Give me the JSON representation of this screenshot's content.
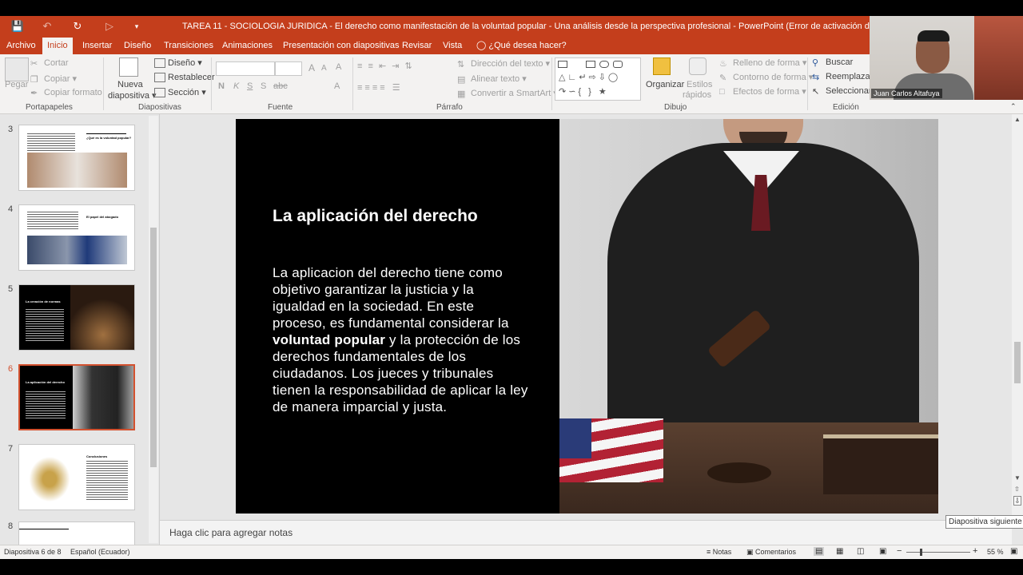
{
  "window": {
    "title": "TAREA 11 - SOCIOLOGIA JURIDICA - El derecho como manifestación de la voluntad popular - Una análisis desde la perspectiva profesional - PowerPoint (Error de activación de productos)"
  },
  "tabs": [
    {
      "label": "Archivo"
    },
    {
      "label": "Inicio"
    },
    {
      "label": "Insertar"
    },
    {
      "label": "Diseño"
    },
    {
      "label": "Transiciones"
    },
    {
      "label": "Animaciones"
    },
    {
      "label": "Presentación con diapositivas"
    },
    {
      "label": "Revisar"
    },
    {
      "label": "Vista"
    }
  ],
  "tell_me": "¿Qué desea hacer?",
  "ribbon": {
    "portapapeles": {
      "label": "Portapapeles",
      "paste": "Pegar",
      "cut": "Cortar",
      "copy": "Copiar",
      "format": "Copiar formato"
    },
    "diapositivas": {
      "label": "Diapositivas",
      "new_line1": "Nueva",
      "new_line2": "diapositiva",
      "layout": "Diseño",
      "reset": "Restablecer",
      "section": "Sección"
    },
    "fuente": {
      "label": "Fuente",
      "bold": "N",
      "italic": "K",
      "underline": "S",
      "strike": "S",
      "shadow": "abc",
      "grow": "A",
      "shrink": "A",
      "clear": "A",
      "font_color": "A"
    },
    "parrafo": {
      "label": "Párrafo",
      "direction": "Dirección del texto",
      "align": "Alinear texto",
      "smartart": "Convertir a SmartArt"
    },
    "dibujo": {
      "label": "Dibujo",
      "arrange": "Organizar",
      "quick1": "Estilos",
      "quick2": "rápidos",
      "fill": "Relleno de forma",
      "outline": "Contorno de forma",
      "effects": "Efectos de forma"
    },
    "edicion": {
      "label": "Edición",
      "find": "Buscar",
      "replace": "Reemplazar",
      "select": "Seleccionar"
    }
  },
  "webcam": {
    "name": "Juan Carlos Altafuya"
  },
  "thumbnails": [
    {
      "num": "3",
      "title": "¿Qué es la voluntad popular?"
    },
    {
      "num": "4",
      "title": "El papel del abogado"
    },
    {
      "num": "5",
      "title": "La creación de normas"
    },
    {
      "num": "6",
      "title": "La aplicación del derecho"
    },
    {
      "num": "7",
      "title": "Conclusiones"
    },
    {
      "num": "8",
      "title": ""
    }
  ],
  "slide": {
    "title": "La aplicación del derecho",
    "body_before": "La aplicacion del derecho tiene como objetivo garantizar la justicia y la igualdad en la sociedad. En este proceso, es fundamental considerar la ",
    "body_bold": "voluntad popular",
    "body_after": " y la protección de los derechos fundamentales de los ciudadanos. Los jueces y tribunales tienen la responsabilidad de aplicar la ley de manera imparcial y justa."
  },
  "notes_placeholder": "Haga clic para agregar notas",
  "tooltip": "Diapositiva siguiente",
  "status": {
    "slide_info": "Diapositiva 6 de 8",
    "language": "Español (Ecuador)",
    "notes": "Notas",
    "comments": "Comentarios",
    "zoom": "55 %"
  },
  "colors": {
    "accent": "#c43e1c",
    "selected": "#d35230"
  }
}
